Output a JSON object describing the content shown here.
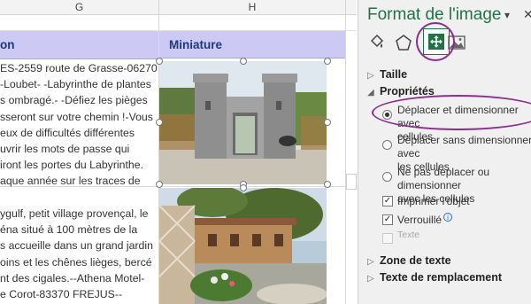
{
  "sheet": {
    "col_g": "G",
    "col_h": "H",
    "header_g": "on",
    "header_h": "Miniature",
    "cell1_lines": [
      "ES-2559 route de Grasse-06270",
      "-Loubet- -Labyrinthe de plantes",
      "s ombragé.- -Défiez les pièges",
      "sseront sur votre chemin !-Vous",
      "eux de difficultés différentes",
      "uvrir les mots de passe qui",
      "iront les portes du Labyrinthe.",
      "aque année sur les traces de"
    ],
    "cell2_lines": [
      "ygulf, petit village provençal, le",
      "éna situé à 100 mètres de la",
      "s accueille dans un grand jardin",
      "oins et les chênes lièges, bercé",
      "nt des cigales.--Athena Motel-",
      "e Corot-83370 FREJUS--"
    ]
  },
  "panel": {
    "title": "Format de l'image",
    "tabs": [
      "fill-line-icon",
      "effects-icon",
      "size-properties-icon",
      "picture-icon"
    ],
    "sections": {
      "taille": "Taille",
      "proprietes": "Propriétés",
      "zone_texte": "Zone de texte",
      "texte_remplacement": "Texte de remplacement"
    },
    "options": {
      "opt1_line1": "Déplacer et dimensionner avec",
      "opt1_line2": "cellules",
      "opt2_line1": "Déplacer sans dimensionner avec",
      "opt2_line2": "les cellules",
      "opt3_line1": "Ne pas déplacer ou dimensionner",
      "opt3_line2": "avec les cellules"
    },
    "checkboxes": {
      "imprimer": "Imprimer l'objet",
      "verrouille": "Verrouillé",
      "texte": "Texte"
    },
    "highlight_color": "#8b2f8f",
    "accent_color": "#217346"
  }
}
